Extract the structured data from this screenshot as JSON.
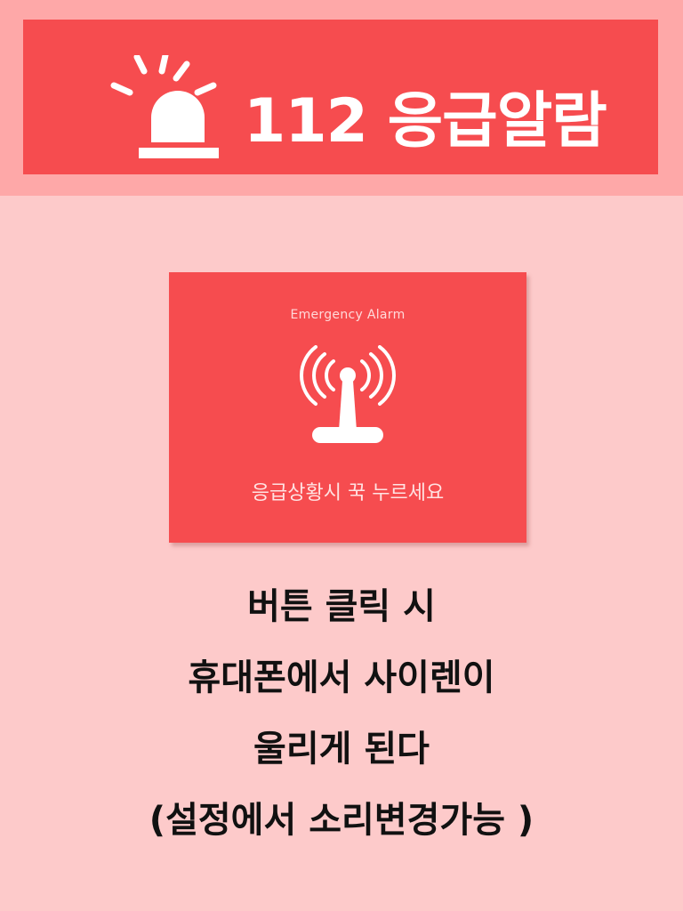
{
  "header": {
    "title": "112 응급알람",
    "icon": "siren-icon"
  },
  "card": {
    "subtitle": "Emergency Alarm",
    "icon": "antenna-signal-icon",
    "caption": "응급상황시 꾹 누르세요"
  },
  "description": {
    "lines": [
      "버튼 클릭 시",
      "휴대폰에서 사이렌이",
      "울리게 된다",
      "(설정에서 소리변경가능 )"
    ]
  },
  "colors": {
    "background": "#fdcaca",
    "top_band": "#fea8a8",
    "accent_red": "#f64c4f",
    "text_white": "#ffffff",
    "text_dark": "#111111"
  }
}
